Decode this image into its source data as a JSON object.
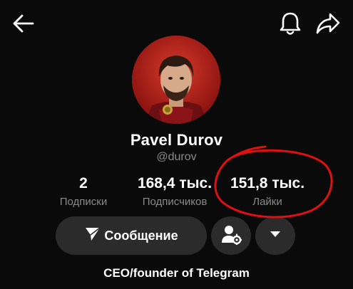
{
  "profile": {
    "name": "Pavel Durov",
    "handle": "@durov",
    "bio": "CEO/founder of Telegram"
  },
  "stats": [
    {
      "value": "2",
      "label": "Подписки"
    },
    {
      "value": "168,4 тыс.",
      "label": "Подписчиков"
    },
    {
      "value": "151,8 тыс.",
      "label": "Лайки"
    }
  ],
  "actions": {
    "message_label": "Сообщение"
  },
  "icons": {
    "back": "arrow-left-icon",
    "notifications": "bell-icon",
    "share": "share-arrow-icon",
    "message": "paper-plane-icon",
    "user_settings": "user-gear-icon",
    "more": "chevron-down-icon"
  },
  "colors": {
    "background": "#0a0a0a",
    "button": "#2b2b2b",
    "secondary_text": "#8a8a8a",
    "annotation": "#e01010"
  }
}
